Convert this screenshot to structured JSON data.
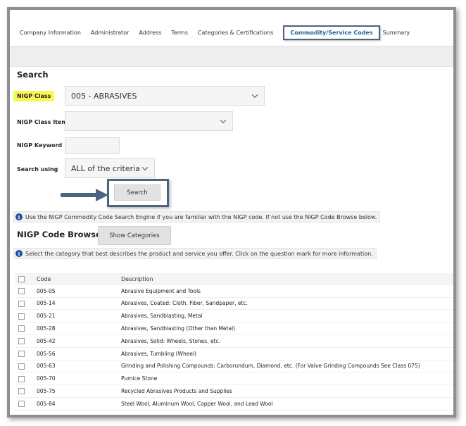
{
  "tabs": [
    "Company Information",
    "Administrator",
    "Address",
    "Terms",
    "Categories & Certifications",
    "Commodity/Service Codes",
    "Summary"
  ],
  "search": {
    "heading": "Search",
    "class_label": "NIGP Class",
    "class_value": "005 - ABRASIVES",
    "item_label": "NIGP Class Item",
    "item_value": "",
    "keyword_label": "NIGP Keyword",
    "keyword_value": "",
    "using_label": "Search using",
    "using_value": "ALL of the criteria",
    "button": "Search"
  },
  "info1": "Use the NIGP Commodity Code Search Engine if you are familiar with the NIGP code. If not use the NIGP Code Browse below.",
  "browse": {
    "heading": "NIGP Code Browse",
    "button": "Show Categories"
  },
  "info2": "Select the category that best describes the product and service you offer. Click on the question mark for more information.",
  "table": {
    "headers": [
      "Code",
      "Description"
    ],
    "rows": [
      {
        "code": "005-05",
        "desc": "Abrasive Equipment and Tools"
      },
      {
        "code": "005-14",
        "desc": "Abrasives, Coated: Cloth, Fiber, Sandpaper, etc."
      },
      {
        "code": "005-21",
        "desc": "Abrasives, Sandblasting, Metal"
      },
      {
        "code": "005-28",
        "desc": "Abrasives, Sandblasting (Other than Metal)"
      },
      {
        "code": "005-42",
        "desc": "Abrasives, Solid: Wheels, Stones, etc."
      },
      {
        "code": "005-56",
        "desc": "Abrasives, Tumbling (Wheel)"
      },
      {
        "code": "005-63",
        "desc": "Grinding and Polishing Compounds: Carborundum, Diamond, etc. (For Valve Grinding Compounds See Class 075)"
      },
      {
        "code": "005-70",
        "desc": "Pumice Stone"
      },
      {
        "code": "005-75",
        "desc": "Recycled Abrasives Products and Supplies"
      },
      {
        "code": "005-84",
        "desc": "Steel Wool, Aluminum Wool, Copper Wool, and Lead Wool"
      }
    ]
  },
  "colors": {
    "highlight": "#f8f850",
    "accent": "#1f5f99",
    "callout": "#4a6580"
  }
}
